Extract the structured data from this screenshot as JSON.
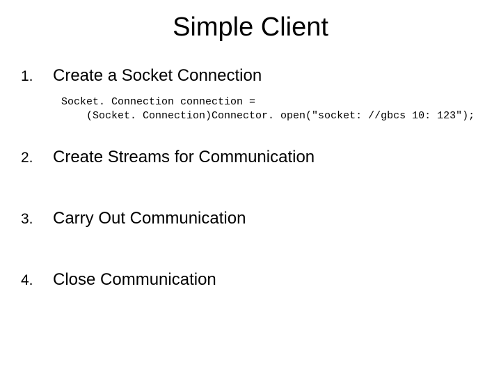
{
  "title": "Simple Client",
  "items": [
    {
      "num": "1.",
      "label": "Create a Socket Connection"
    },
    {
      "num": "2.",
      "label": "Create Streams for Communication"
    },
    {
      "num": "3.",
      "label": "Carry Out Communication"
    },
    {
      "num": "4.",
      "label": "Close Communication"
    }
  ],
  "code": "Socket. Connection connection =\n    (Socket. Connection)Connector. open(\"socket: //gbcs 10: 123\");"
}
